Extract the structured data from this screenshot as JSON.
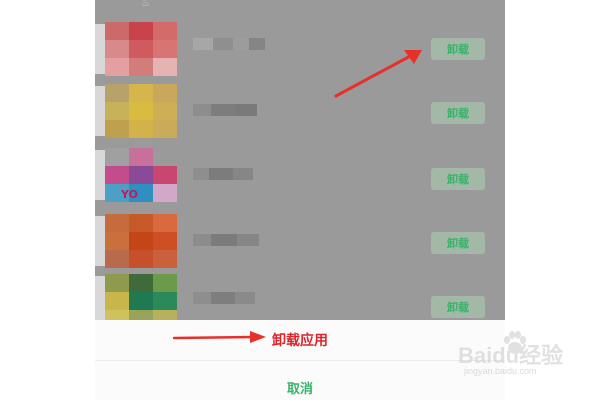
{
  "apps": [
    {
      "uninstall_label": "卸载",
      "icon_colors": [
        "#cc6a6a",
        "#c8434c",
        "#d46b6b",
        "#d88a8a",
        "#cf5a5f",
        "#d97474",
        "#e4a0a0",
        "#d37c7c",
        "#e7b2b2"
      ],
      "name_colors": [
        "#a7a7a7",
        "#8f8f8f",
        "#9c9c9c",
        "#858585"
      ]
    },
    {
      "uninstall_label": "卸载",
      "icon_colors": [
        "#b7a36a",
        "#d6b64b",
        "#c9a85c",
        "#c7b159",
        "#d9bb3f",
        "#cdb055",
        "#bfa04e",
        "#d4b24a",
        "#c9ab5a"
      ],
      "name_colors": [
        "#8d8d8d",
        "#7d7d7d",
        "#7a7a7a"
      ]
    },
    {
      "uninstall_label": "卸载",
      "icon_colors": [
        "#a0a0a0",
        "#c6709a",
        "#9a9a9a",
        "#c24c8c",
        "#8b4a98",
        "#c94670",
        "#4ca0c6",
        "#2f8fc0",
        "#d2a8c8"
      ],
      "icon_text": "YO",
      "name_colors": [
        "#8e8e8e",
        "#7c7c7c",
        "#868686"
      ]
    },
    {
      "uninstall_label": "卸载",
      "icon_colors": [
        "#c66b3e",
        "#c85a2a",
        "#d96a3f",
        "#c9703c",
        "#c44618",
        "#cf4f24",
        "#b96a4a",
        "#c5502a",
        "#c8613c"
      ],
      "name_colors": [
        "#8c8c8c",
        "#7b7b7b",
        "#868686"
      ]
    },
    {
      "uninstall_label": "卸载",
      "icon_colors": [
        "#8f9a4f",
        "#3f6b3a",
        "#6a9a4a",
        "#c8b64a",
        "#1f7a52",
        "#2a8a5a",
        "#cfc25c",
        "#9aa35a",
        "#b8b05a"
      ],
      "name_colors": [
        "#8e8e8e",
        "#7e7e7e",
        "#8a8a8a"
      ]
    }
  ],
  "sheet": {
    "title": "卸载应用",
    "cancel": "取消"
  },
  "watermark": {
    "title": "Baidu经验",
    "url": "jingyan.baidu.com"
  },
  "colors": {
    "accent_green": "#38b36a",
    "title_red": "#d9262a",
    "arrow_red": "#e8302a",
    "overlay": "#9a9a9a"
  }
}
